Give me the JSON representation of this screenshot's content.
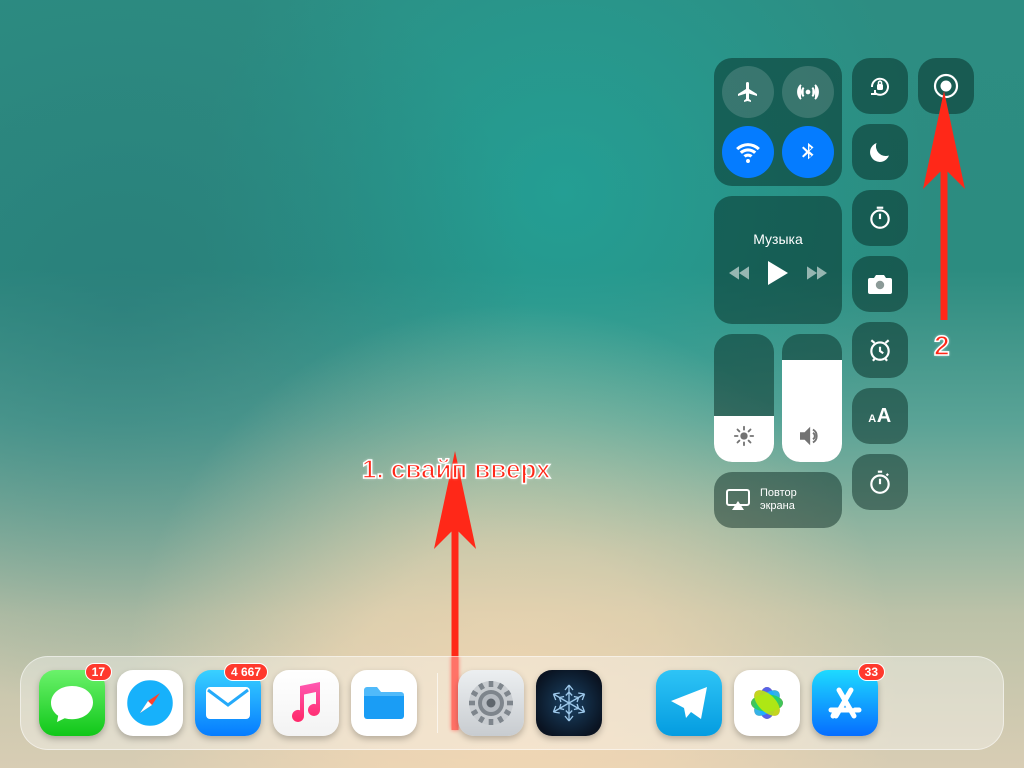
{
  "controlCenter": {
    "music_title": "Музыка",
    "brightness_level_pct": 36,
    "volume_level_pct": 80,
    "mirror_label": "Повтор\nэкрана"
  },
  "annotations": {
    "swipe_label": "1. свайп вверх",
    "record_label": "2"
  },
  "dock": {
    "apps": [
      {
        "name": "messages",
        "badge": "17"
      },
      {
        "name": "safari",
        "badge": null
      },
      {
        "name": "mail",
        "badge": "4 667"
      },
      {
        "name": "music",
        "badge": null
      },
      {
        "name": "files",
        "badge": null
      },
      {
        "name": "settings",
        "badge": null
      },
      {
        "name": "snowflake",
        "badge": null
      },
      {
        "name": "telegram",
        "badge": null
      },
      {
        "name": "photos",
        "badge": null
      },
      {
        "name": "appstore",
        "badge": "33"
      }
    ]
  }
}
